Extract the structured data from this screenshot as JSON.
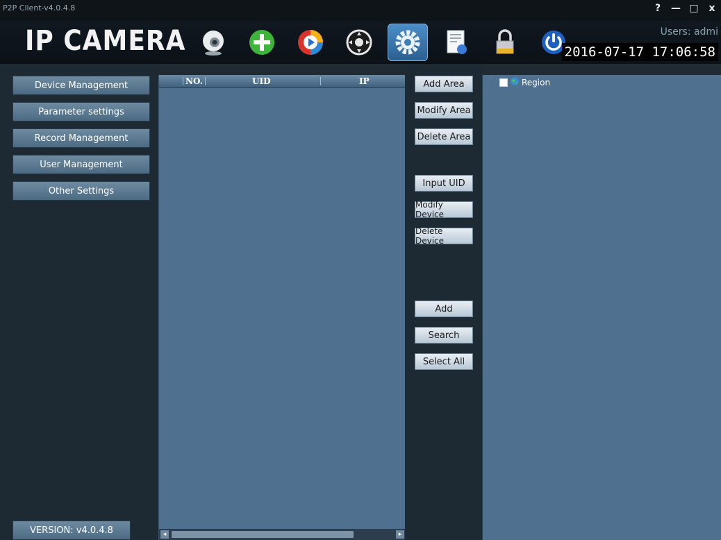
{
  "window": {
    "title": "P2P Client-v4.0.4.8",
    "controls": {
      "help": "?",
      "minimize": "—",
      "maximize": "□",
      "close": "x"
    }
  },
  "header": {
    "logo": "IP CAMERA",
    "users_text": "Users: admi",
    "datetime": "2016-07-17 17:06:58",
    "toolbar_icons": [
      "webcam-icon",
      "add-icon",
      "playback-icon",
      "ptz-control-icon",
      "settings-icon",
      "log-document-icon",
      "lock-icon",
      "power-icon"
    ],
    "active_icon": "settings-icon"
  },
  "sidebar": {
    "items": [
      {
        "label": "Device Management"
      },
      {
        "label": "Parameter settings"
      },
      {
        "label": "Record Management"
      },
      {
        "label": "User Management"
      },
      {
        "label": "Other Settings"
      }
    ],
    "version": "VERSION: v4.0.4.8"
  },
  "device_table": {
    "columns": [
      "NO.",
      "UID",
      "IP"
    ],
    "rows": []
  },
  "actions": {
    "add_area": "Add Area",
    "modify_area": "Modify Area",
    "delete_area": "Delete Area",
    "input_uid": "Input UID",
    "modify_device": "Modify Device",
    "delete_device": "Delete Device",
    "add": "Add",
    "search": "Search",
    "select_all": "Select All"
  },
  "region_tree": {
    "root_label": "Region",
    "checked": false
  },
  "colors": {
    "panel_blue": "#50708f",
    "dark_bg": "#1f2a33",
    "nav_button": "#5d7b91",
    "active_icon_bg": "#3f7fb8"
  }
}
